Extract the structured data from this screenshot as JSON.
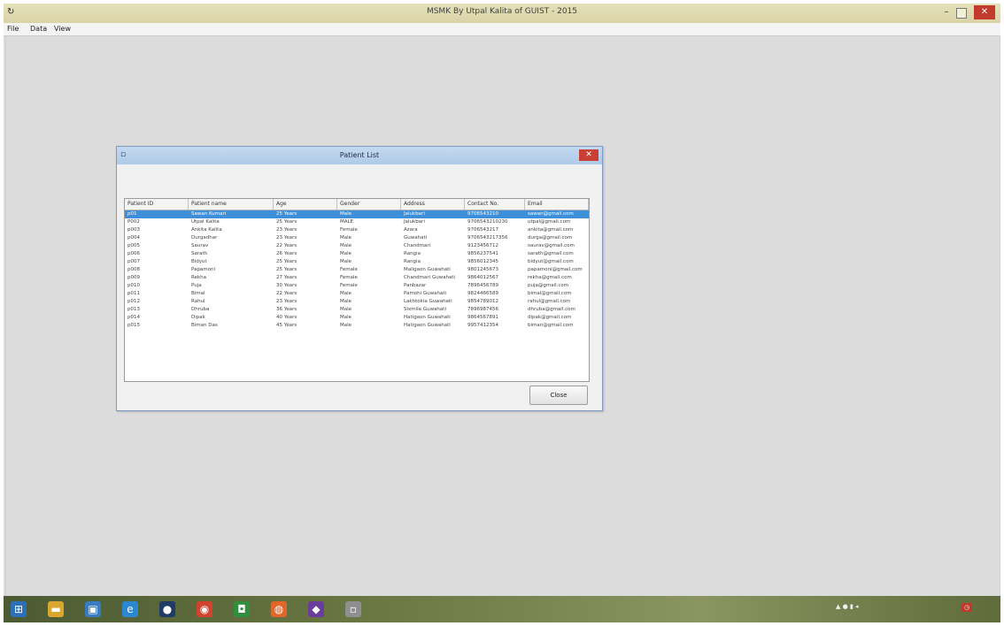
{
  "window": {
    "title": "MSMK  By Utpal Kalita of GUIST - 2015",
    "min_glyph": "–",
    "close_glyph": "✕"
  },
  "menu": [
    "File",
    "Data",
    "View"
  ],
  "dialog": {
    "title": "Patient List",
    "close_glyph": "✕",
    "columns": [
      "Patient ID",
      "Patient name",
      "Age",
      "Gender",
      "Address",
      "Contact No.",
      "Email"
    ],
    "rows": [
      [
        "p01",
        "Sawan Kumari",
        "25 Years",
        "Male",
        "Jalukbari",
        "9706543210",
        "sawan@gmail.com"
      ],
      [
        "P002",
        "Utpal Kalita",
        "25 Years",
        "MALE",
        "Jalukbari",
        "9706543210230",
        "utpal@gmail.com"
      ],
      [
        "p003",
        "Ankita Kalita",
        "23 Years",
        "Female",
        "Azara",
        "9706543217",
        "ankita@gmail.com"
      ],
      [
        "p004",
        "Durgadhar",
        "23 Years",
        "Male",
        "Guwahati",
        "9706543217356",
        "durga@gmail.com"
      ],
      [
        "p005",
        "Saurav",
        "22 Years",
        "Male",
        "Chandmari",
        "9123456712",
        "saurav@gmail.com"
      ],
      [
        "p006",
        "Sarath",
        "26 Years",
        "Male",
        "Rangia",
        "9856237541",
        "sarath@gmail.com"
      ],
      [
        "p007",
        "Bidyut",
        "25 Years",
        "Male",
        "Rangia",
        "9856012345",
        "bidyut@gmail.com"
      ],
      [
        "p008",
        "Papamoni",
        "25 Years",
        "Female",
        "Maligaon Guwahati",
        "9801245673",
        "papamoni@gmail.com"
      ],
      [
        "p009",
        "Rekha",
        "27 Years",
        "Female",
        "Chandmari Guwahati",
        "9864012567",
        "rekha@gmail.com"
      ],
      [
        "p010",
        "Puja",
        "30 Years",
        "Female",
        "Panbazar",
        "7896456789",
        "puja@gmail.com"
      ],
      [
        "p011",
        "Bimal",
        "22 Years",
        "Male",
        "Pamohi Guwahati",
        "9824466589",
        "bimal@gmail.com"
      ],
      [
        "p012",
        "Rahul",
        "23 Years",
        "Male",
        "Lakhtokia Guwahati",
        "9854789012",
        "rahul@gmail.com"
      ],
      [
        "p013",
        "Dhruba",
        "36 Years",
        "Male",
        "Sixmile Guwahati",
        "7896987456",
        "dhruba@gmail.com"
      ],
      [
        "p014",
        "Dipak",
        "40 Years",
        "Male",
        "Hatigaon Guwahati",
        "9864567891",
        "dipak@gmail.com"
      ],
      [
        "p015",
        "Biman Das",
        "45 Years",
        "Male",
        "Hatigaon Guwahati",
        "9957412354",
        "biman@gmail.com"
      ]
    ],
    "selected_row": 0,
    "close_button": "Close"
  },
  "taskbar": {
    "icons": [
      {
        "name": "start-icon",
        "glyph": "⊞",
        "color": "#2d6fb8"
      },
      {
        "name": "file-explorer-icon",
        "glyph": "▬",
        "color": "#d9a62e"
      },
      {
        "name": "computer-icon",
        "glyph": "▣",
        "color": "#3a7cc2"
      },
      {
        "name": "internet-explorer-icon",
        "glyph": "e",
        "color": "#2c87d1"
      },
      {
        "name": "media-player-icon",
        "glyph": "●",
        "color": "#1f3b66"
      },
      {
        "name": "chrome-icon",
        "glyph": "◉",
        "color": "#d2432f"
      },
      {
        "name": "app-icon",
        "glyph": "◘",
        "color": "#2f8f3c"
      },
      {
        "name": "firefox-icon",
        "glyph": "◍",
        "color": "#e0662a"
      },
      {
        "name": "visual-studio-icon",
        "glyph": "◆",
        "color": "#6a3c9c"
      },
      {
        "name": "running-app-icon",
        "glyph": "▫",
        "color": "#8f8f8f"
      }
    ]
  }
}
